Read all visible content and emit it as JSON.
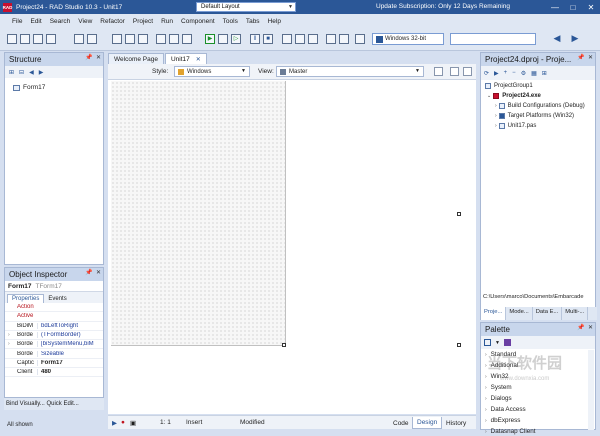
{
  "window": {
    "title": "Project24 - RAD Studio 10.3 - Unit17",
    "layout": "Default Layout",
    "promo": "Update Subscription: Only 12 Days Remaining",
    "app_icon": "RAD"
  },
  "menu": [
    "File",
    "Edit",
    "Search",
    "View",
    "Refactor",
    "Project",
    "Run",
    "Component",
    "Tools",
    "Tabs",
    "Help"
  ],
  "toolbar": {
    "platform": "Windows 32-bit"
  },
  "structure": {
    "title": "Structure",
    "items": [
      "Form17"
    ]
  },
  "inspector": {
    "title": "Object Inspector",
    "object": "Form17",
    "class": "TForm17",
    "tabs": [
      "Properties",
      "Events"
    ],
    "rows": [
      {
        "name": "Action",
        "value": "",
        "style": "red",
        "exp": ""
      },
      {
        "name": "Active",
        "value": "",
        "style": "red",
        "exp": ""
      },
      {
        "name": "BiDiM",
        "value": "bdLeftToRight",
        "style": "",
        "exp": ""
      },
      {
        "name": "Borde",
        "value": "(TFormBorder)",
        "style": "",
        "exp": "›"
      },
      {
        "name": "Borde",
        "value": "[biSystemMenu,biM",
        "style": "",
        "exp": "›"
      },
      {
        "name": "Borde",
        "value": "Sizeable",
        "style": "",
        "exp": ""
      },
      {
        "name": "Captic",
        "value": "Form17",
        "style": "bold",
        "exp": ""
      },
      {
        "name": "Client",
        "value": "480",
        "style": "bold",
        "exp": ""
      }
    ],
    "links": "Bind Visually...  Quick Edit...",
    "footer": "All shown"
  },
  "editor": {
    "tabs": [
      {
        "label": "Welcome Page",
        "active": false,
        "close": ""
      },
      {
        "label": "Unit17",
        "active": true,
        "close": "✕"
      }
    ],
    "style_label": "Style:",
    "style_value": "Windows",
    "view_label": "View:",
    "view_value": "Master",
    "status": {
      "position": "1:  1",
      "mode": "Insert",
      "state": "Modified"
    },
    "bottom_tabs": [
      "Code",
      "Design",
      "History"
    ]
  },
  "project": {
    "title": "Project24.dproj - Proje...",
    "tree": [
      {
        "label": "ProjectGroup1",
        "bold": false
      },
      {
        "label": "Project24.exe",
        "bold": true
      },
      {
        "label": "Build Configurations (Debug)",
        "bold": false
      },
      {
        "label": "Target Platforms (Win32)",
        "bold": false
      },
      {
        "label": "Unit17.pas",
        "bold": false
      }
    ],
    "path": "C:\\Users\\marco\\Documents\\Embarcade",
    "tabs": [
      "Proje...",
      "Mode...",
      "Data E...",
      "Multi-..."
    ]
  },
  "palette": {
    "title": "Palette",
    "items": [
      "Standard",
      "Additional",
      "Win32",
      "System",
      "Dialogs",
      "Data Access",
      "dbExpress",
      "Datasnap Client"
    ]
  },
  "watermark": {
    "text": "当下软件园",
    "sub": "www.downxia.com"
  }
}
